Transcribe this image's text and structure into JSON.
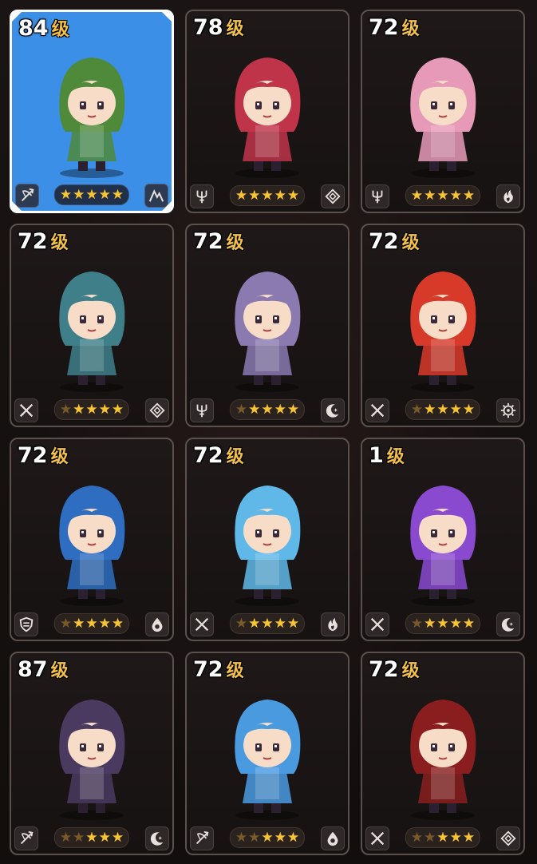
{
  "level_unit": "级",
  "colors": {
    "selected_bg": "#3b8fe6",
    "star_on": "#f7c437",
    "star_off": "#7a5a2a",
    "unit_gold": "#f3c04a"
  },
  "characters": [
    {
      "level": "84",
      "selected": true,
      "role_icon": "bow-icon",
      "element_icon": "mountain-icon",
      "stars_total": 5,
      "stars_lit": 5,
      "portrait": "dinosaur-costume-girl",
      "hue": "#4f8a3a"
    },
    {
      "level": "78",
      "selected": false,
      "role_icon": "trident-icon",
      "element_icon": "diamond-icon",
      "stars_total": 5,
      "stars_lit": 5,
      "portrait": "red-hat-girl-with-bears",
      "hue": "#c0344a"
    },
    {
      "level": "72",
      "selected": false,
      "role_icon": "trident-icon",
      "element_icon": "fire-icon",
      "stars_total": 5,
      "stars_lit": 5,
      "portrait": "flower-hat-girl",
      "hue": "#e79ab8"
    },
    {
      "level": "72",
      "selected": false,
      "role_icon": "swords-icon",
      "element_icon": "diamond-icon",
      "stars_total": 5,
      "stars_lit": 4,
      "portrait": "cap-girl-with-lantern",
      "hue": "#3e7f8a"
    },
    {
      "level": "72",
      "selected": false,
      "role_icon": "trident-icon",
      "element_icon": "moon-icon",
      "stars_total": 5,
      "stars_lit": 4,
      "portrait": "silver-haired-knight",
      "hue": "#8a7ab0"
    },
    {
      "level": "72",
      "selected": false,
      "role_icon": "swords-icon",
      "element_icon": "gear-icon",
      "stars_total": 5,
      "stars_lit": 4,
      "portrait": "red-ponytail-girl",
      "hue": "#d83a2a"
    },
    {
      "level": "72",
      "selected": false,
      "role_icon": "shield-icon",
      "element_icon": "water-icon",
      "stars_total": 5,
      "stars_lit": 4,
      "portrait": "shark-hood-girl",
      "hue": "#2e6dc0"
    },
    {
      "level": "72",
      "selected": false,
      "role_icon": "swords-icon",
      "element_icon": "fire-icon",
      "stars_total": 5,
      "stars_lit": 4,
      "portrait": "crystal-encased-girl",
      "hue": "#5fb8e8"
    },
    {
      "level": "1",
      "selected": false,
      "role_icon": "swords-icon",
      "element_icon": "moon-icon",
      "stars_total": 5,
      "stars_lit": 4,
      "portrait": "horned-demon-girl",
      "hue": "#8a4ad0"
    },
    {
      "level": "87",
      "selected": false,
      "role_icon": "bow-icon",
      "element_icon": "moon-icon",
      "stars_total": 5,
      "stars_lit": 3,
      "portrait": "dark-armored-girl",
      "hue": "#4a3a60"
    },
    {
      "level": "72",
      "selected": false,
      "role_icon": "bow-icon",
      "element_icon": "water-icon",
      "stars_total": 5,
      "stars_lit": 3,
      "portrait": "fox-girl-with-airplane",
      "hue": "#4a9ae0"
    },
    {
      "level": "72",
      "selected": false,
      "role_icon": "swords-icon",
      "element_icon": "diamond-icon",
      "stars_total": 5,
      "stars_lit": 3,
      "portrait": "pirate-hat-girl",
      "hue": "#8a1e1e"
    }
  ]
}
